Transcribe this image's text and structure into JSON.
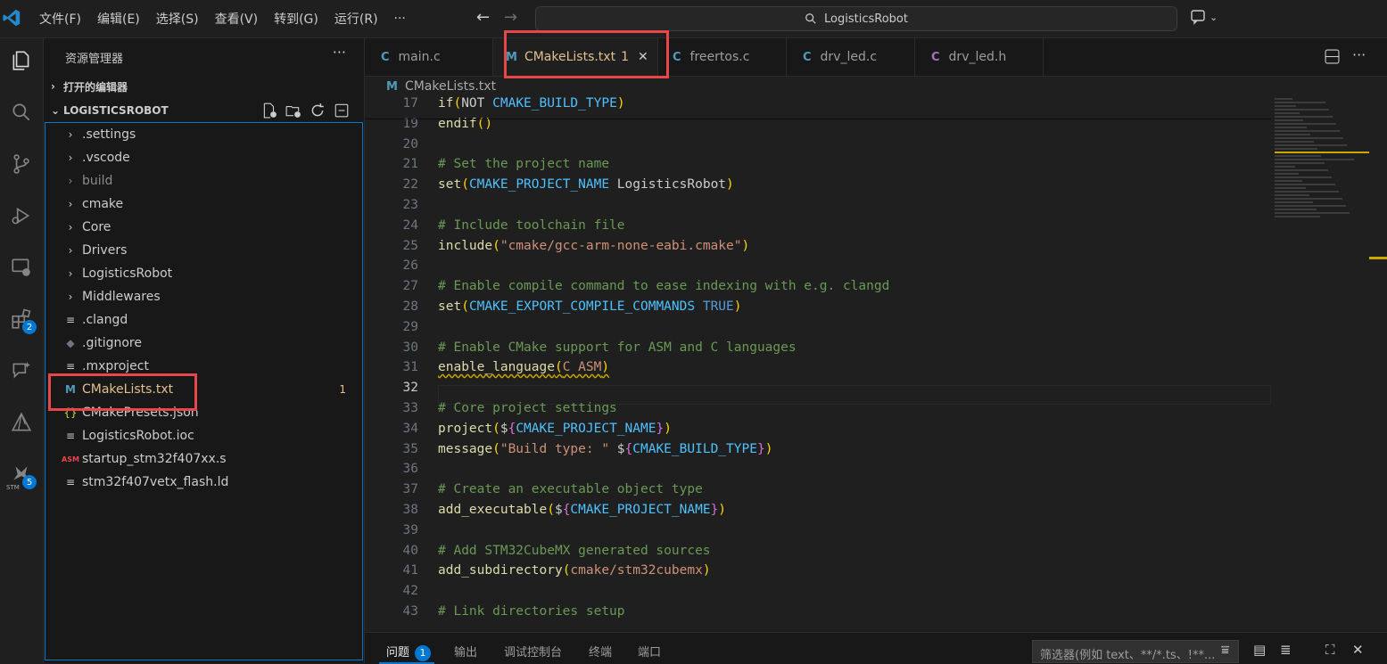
{
  "titlebar": {
    "menu": [
      "文件(F)",
      "编辑(E)",
      "选择(S)",
      "查看(V)",
      "转到(G)",
      "运行(R)",
      "···"
    ],
    "search_text": "LogisticsRobot"
  },
  "activity_badges": {
    "extensions": "2",
    "stm": "5",
    "stm_label": "STM"
  },
  "sidebar": {
    "title": "资源管理器",
    "more": "···",
    "open_editors": "打开的编辑器",
    "project": "LOGISTICSROBOT",
    "items": [
      {
        "label": ".settings",
        "icon": "›"
      },
      {
        "label": ".vscode",
        "icon": "›"
      },
      {
        "label": "build",
        "icon": "›"
      },
      {
        "label": "cmake",
        "icon": "›"
      },
      {
        "label": "Core",
        "icon": "›"
      },
      {
        "label": "Drivers",
        "icon": "›"
      },
      {
        "label": "LogisticsRobot",
        "icon": "›"
      },
      {
        "label": "Middlewares",
        "icon": "›"
      },
      {
        "label": ".clangd",
        "icon": "≡"
      },
      {
        "label": ".gitignore",
        "icon": "◆"
      },
      {
        "label": ".mxproject",
        "icon": "≡"
      },
      {
        "label": "CMakeLists.txt",
        "icon": "M",
        "count": "1"
      },
      {
        "label": "CMakePresets.json",
        "icon": "{}"
      },
      {
        "label": "LogisticsRobot.ioc",
        "icon": "≡"
      },
      {
        "label": "startup_stm32f407xx.s",
        "icon": "ASM"
      },
      {
        "label": "stm32f407vetx_flash.ld",
        "icon": "≡"
      }
    ]
  },
  "tabs": [
    {
      "label": "main.c",
      "icon": "C"
    },
    {
      "label": "CMakeLists.txt",
      "icon": "M",
      "count": "1",
      "close": "✕"
    },
    {
      "label": "freertos.c",
      "icon": "C"
    },
    {
      "label": "drv_led.c",
      "icon": "C"
    },
    {
      "label": "drv_led.h",
      "icon": "C"
    }
  ],
  "breadcrumb": {
    "icon": "M",
    "file": "CMakeLists.txt"
  },
  "code_lines": [
    {
      "n": "17",
      "segs": [
        [
          "kw",
          "if"
        ],
        [
          "pn",
          "("
        ],
        [
          "id",
          "NOT "
        ],
        [
          "vr",
          "CMAKE_BUILD_TYPE"
        ],
        [
          "pn",
          ")"
        ]
      ]
    },
    {
      "n": "19",
      "segs": [
        [
          "kw",
          "endif"
        ],
        [
          "pn",
          "()"
        ]
      ]
    },
    {
      "n": "20",
      "segs": []
    },
    {
      "n": "21",
      "segs": [
        [
          "cm",
          "# Set the project name"
        ]
      ]
    },
    {
      "n": "22",
      "segs": [
        [
          "kw",
          "set"
        ],
        [
          "pn",
          "("
        ],
        [
          "vr",
          "CMAKE_PROJECT_NAME"
        ],
        [
          "id",
          " LogisticsRobot"
        ],
        [
          "pn",
          ")"
        ]
      ]
    },
    {
      "n": "23",
      "segs": []
    },
    {
      "n": "24",
      "segs": [
        [
          "cm",
          "# Include toolchain file"
        ]
      ]
    },
    {
      "n": "25",
      "segs": [
        [
          "kw",
          "include"
        ],
        [
          "pn",
          "("
        ],
        [
          "st",
          "\"cmake/gcc-arm-none-eabi.cmake\""
        ],
        [
          "pn",
          ")"
        ]
      ]
    },
    {
      "n": "26",
      "segs": []
    },
    {
      "n": "27",
      "segs": [
        [
          "cm",
          "# Enable compile command to ease indexing with e.g. clangd"
        ]
      ]
    },
    {
      "n": "28",
      "segs": [
        [
          "kw",
          "set"
        ],
        [
          "pn",
          "("
        ],
        [
          "vr",
          "CMAKE_EXPORT_COMPILE_COMMANDS"
        ],
        [
          "id",
          " "
        ],
        [
          "bl",
          "TRUE"
        ],
        [
          "pn",
          ")"
        ]
      ]
    },
    {
      "n": "29",
      "segs": []
    },
    {
      "n": "30",
      "segs": [
        [
          "cm",
          "# Enable CMake support for ASM and C languages"
        ]
      ]
    },
    {
      "n": "31",
      "segs": [
        [
          "kw squig",
          "enable_language"
        ],
        [
          "pn squig",
          "("
        ],
        [
          "st squig",
          "C ASM"
        ],
        [
          "pn squig",
          ")"
        ]
      ]
    },
    {
      "n": "32",
      "segs": []
    },
    {
      "n": "33",
      "segs": [
        [
          "cm",
          "# Core project settings"
        ]
      ]
    },
    {
      "n": "34",
      "segs": [
        [
          "kw",
          "project"
        ],
        [
          "pn",
          "("
        ],
        [
          "id",
          "$"
        ],
        [
          "br",
          "{"
        ],
        [
          "vr",
          "CMAKE_PROJECT_NAME"
        ],
        [
          "br",
          "}"
        ],
        [
          "pn",
          ")"
        ]
      ]
    },
    {
      "n": "35",
      "segs": [
        [
          "kw",
          "message"
        ],
        [
          "pn",
          "("
        ],
        [
          "st",
          "\"Build type: \""
        ],
        [
          "id",
          " $"
        ],
        [
          "br",
          "{"
        ],
        [
          "vr",
          "CMAKE_BUILD_TYPE"
        ],
        [
          "br",
          "}"
        ],
        [
          "pn",
          ")"
        ]
      ]
    },
    {
      "n": "36",
      "segs": []
    },
    {
      "n": "37",
      "segs": [
        [
          "cm",
          "# Create an executable object type"
        ]
      ]
    },
    {
      "n": "38",
      "segs": [
        [
          "kw",
          "add_executable"
        ],
        [
          "pn",
          "("
        ],
        [
          "id",
          "$"
        ],
        [
          "br",
          "{"
        ],
        [
          "vr",
          "CMAKE_PROJECT_NAME"
        ],
        [
          "br",
          "}"
        ],
        [
          "pn",
          ")"
        ]
      ]
    },
    {
      "n": "39",
      "segs": []
    },
    {
      "n": "40",
      "segs": [
        [
          "cm",
          "# Add STM32CubeMX generated sources"
        ]
      ]
    },
    {
      "n": "41",
      "segs": [
        [
          "kw",
          "add_subdirectory"
        ],
        [
          "pn",
          "("
        ],
        [
          "st",
          "cmake/stm32cubemx"
        ],
        [
          "pn",
          ")"
        ]
      ]
    },
    {
      "n": "42",
      "segs": []
    },
    {
      "n": "43",
      "segs": [
        [
          "cm",
          "# Link directories setup"
        ]
      ]
    }
  ],
  "current_line": "32",
  "panel": {
    "tabs": [
      "问题",
      "输出",
      "调试控制台",
      "终端",
      "端口"
    ],
    "problems_count": "1",
    "filter_placeholder": "筛选器(例如 text、**/*.ts、!**..."
  },
  "colors": {
    "accent": "#0078d4",
    "highlight": "#e5474b",
    "modified": "#e2c08d"
  }
}
